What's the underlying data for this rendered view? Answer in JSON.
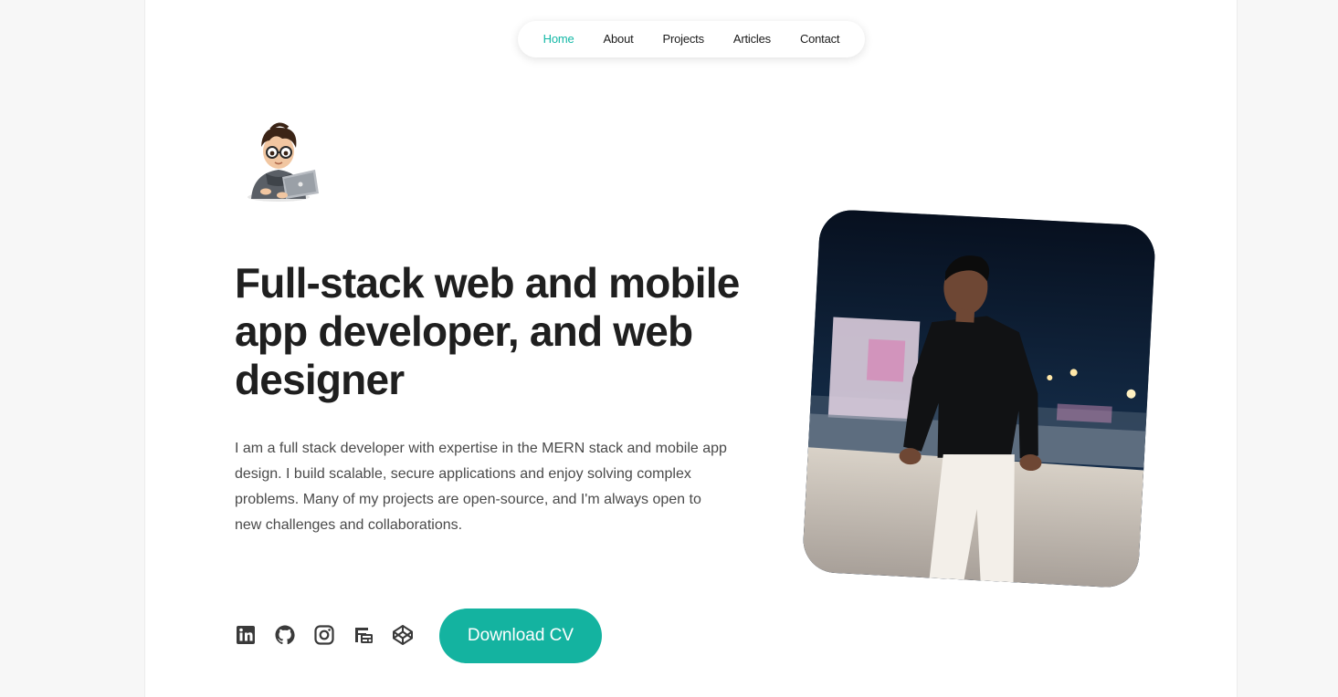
{
  "nav": {
    "items": [
      {
        "label": "Home",
        "active": true
      },
      {
        "label": "About",
        "active": false
      },
      {
        "label": "Projects",
        "active": false
      },
      {
        "label": "Articles",
        "active": false
      },
      {
        "label": "Contact",
        "active": false
      }
    ]
  },
  "hero": {
    "headline": "Full-stack web and mobile app developer, and web designer",
    "intro": "I am a full stack developer with expertise in the MERN stack and mobile app design. I build scalable, secure applications and enjoy solving complex problems. Many of my projects are open-source, and I'm always open to new challenges and collaborations.",
    "cta_label": "Download CV"
  },
  "socials": [
    {
      "icon": "linkedin-icon"
    },
    {
      "icon": "github-icon"
    },
    {
      "icon": "instagram-icon"
    },
    {
      "icon": "fiverr-icon"
    },
    {
      "icon": "codepen-icon"
    }
  ],
  "colors": {
    "accent": "#14b3a0",
    "nav_active": "#14b8a6",
    "text_dark": "#1f1f1f",
    "text_body": "#4a4a4a"
  }
}
